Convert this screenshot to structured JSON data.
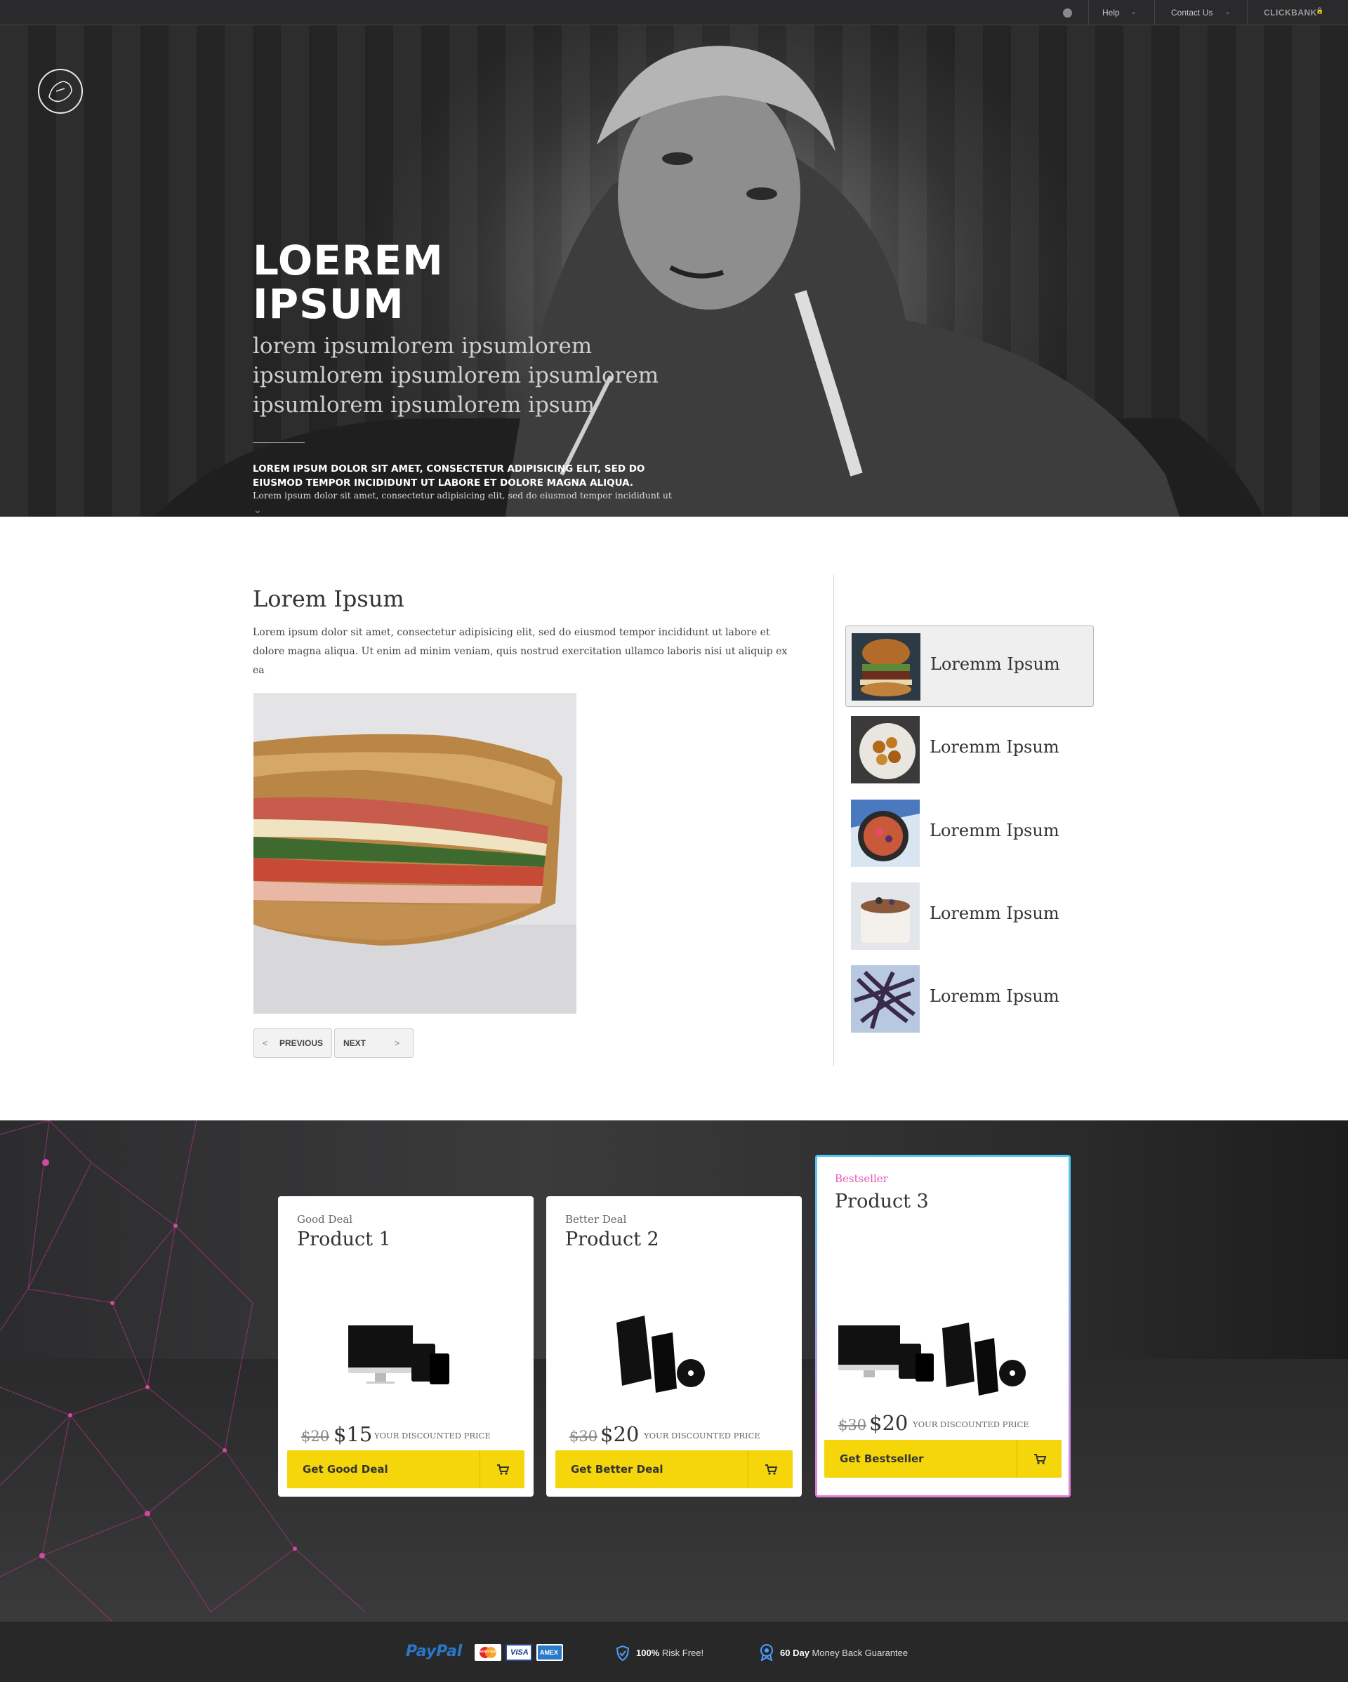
{
  "topbar": {
    "help_label": "Help",
    "contact_label": "Contact Us",
    "brand_label": "CLICKBANK"
  },
  "hero": {
    "title": "LOEREM IPSUM",
    "subtitle": "lorem ipsumlorem ipsumlorem ipsumlorem ipsumlorem ipsumlorem ipsumlorem ipsumlorem ipsum",
    "bold_text": "LOREM IPSUM DOLOR SIT AMET, CONSECTETUR ADIPISICING ELIT, SED DO EIUSMOD TEMPOR INCIDIDUNT UT LABORE ET DOLORE MAGNA ALIQUA.",
    "small_text": "Lorem ipsum dolor sit amet, consectetur adipisicing elit, sed do eiusmod tempor incididunt ut",
    "down_icon": "chevron-down-icon"
  },
  "content": {
    "heading": "Lorem Ipsum",
    "paragraph": "Lorem ipsum dolor sit amet, consectetur adipisicing elit, sed do eiusmod tempor incididunt ut labore et dolore magna aliqua. Ut enim ad minim veniam, quis nostrud exercitation ullamco laboris nisi ut aliquip ex ea",
    "image_icon": "sandwich-image",
    "prev_label": "PREVIOUS",
    "next_label": "NEXT"
  },
  "sidebar": {
    "items": [
      {
        "label": "Loremm Ipsum",
        "image": "burger-image",
        "active": true
      },
      {
        "label": "Loremm Ipsum",
        "image": "bowl-image",
        "active": false
      },
      {
        "label": "Loremm Ipsum",
        "image": "skillet-image",
        "active": false
      },
      {
        "label": "Loremm Ipsum",
        "image": "cake-image",
        "active": false
      },
      {
        "label": "Loremm Ipsum",
        "image": "beans-image",
        "active": false
      }
    ]
  },
  "pricing": {
    "cards": [
      {
        "tag": "Good Deal",
        "name": "Product 1",
        "old_price": "$20",
        "new_price": "$15",
        "discount_label": "YOUR DISCOUNTED PRICE",
        "button": "Get Good Deal"
      },
      {
        "tag": "Better Deal",
        "name": "Product 2",
        "old_price": "$30",
        "new_price": "$20",
        "discount_label": "YOUR DISCOUNTED PRICE",
        "button": "Get Better Deal"
      },
      {
        "tag": "Bestseller",
        "name": "Product 3",
        "old_price": "$30",
        "new_price": "$20",
        "discount_label": "YOUR DISCOUNTED PRICE",
        "button": "Get Bestseller"
      }
    ],
    "colors": {
      "button": "#f4d60a",
      "bestseller_tag": "#e455b8",
      "highlight_border_top": "#4fc8f2",
      "highlight_border_bottom": "#e37ed8"
    }
  },
  "footer": {
    "paypal_label": "PayPal",
    "mastercard_label": "MasterCard",
    "visa_label": "VISA",
    "amex_label": "AMEX",
    "risk_bold": "100%",
    "risk_text": "Risk Free!",
    "guarantee_bold": "60 Day",
    "guarantee_text": "Money Back Guarantee"
  }
}
